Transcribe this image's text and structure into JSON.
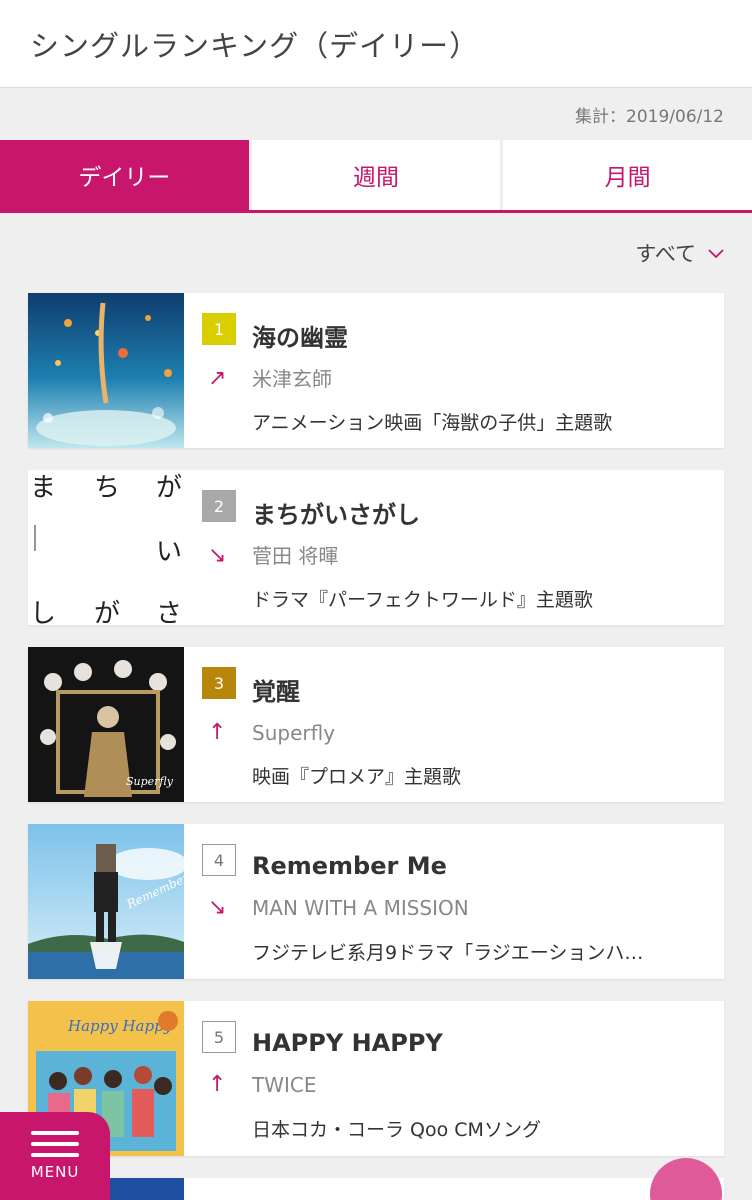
{
  "header": {
    "title": "シングルランキング（デイリー）"
  },
  "summary": {
    "date_text": "集計：2019/06/12"
  },
  "tabs": [
    {
      "label": "デイリー",
      "active": true
    },
    {
      "label": "週間",
      "active": false
    },
    {
      "label": "月間",
      "active": false
    }
  ],
  "filter": {
    "selected": "すべて",
    "icon": "chevron-down-icon"
  },
  "accent_color": "#c8166d",
  "rankings": [
    {
      "rank": "1",
      "badge_color": "#d8cf00",
      "trend": "↗",
      "title": "海の幽霊",
      "artist": "米津玄師",
      "tieup": "アニメーション映画「海獣の子供」主題歌"
    },
    {
      "rank": "2",
      "badge_color": "#a8a8a8",
      "trend": "↘",
      "title": "まちがいさがし",
      "artist": "菅田 将暉",
      "tieup": "ドラマ『パーフェクトワールド』主題歌"
    },
    {
      "rank": "3",
      "badge_color": "#b8860b",
      "trend": "↑",
      "title": "覚醒",
      "artist": "Superfly",
      "tieup": "映画『プロメア』主題歌"
    },
    {
      "rank": "4",
      "badge_color": "",
      "trend": "↘",
      "title": "Remember Me",
      "artist": "MAN WITH A MISSION",
      "tieup": "フジテレビ系月9ドラマ「ラジエーションハ…"
    },
    {
      "rank": "5",
      "badge_color": "",
      "trend": "↑",
      "title": "HAPPY HAPPY",
      "artist": "TWICE",
      "tieup": "日本コカ・コーラ Qoo CMソング"
    }
  ],
  "jacket_texts": {
    "machigai": {
      "row1": [
        "ま",
        "ち",
        "が"
      ],
      "row2": [
        "い"
      ],
      "row3": [
        "し",
        "が",
        "さ"
      ]
    },
    "kakusei_logo": "Superfly",
    "remember_logo": "Remember Me",
    "happy_logo": "Happy Happy"
  },
  "menu": {
    "label": "MENU"
  }
}
